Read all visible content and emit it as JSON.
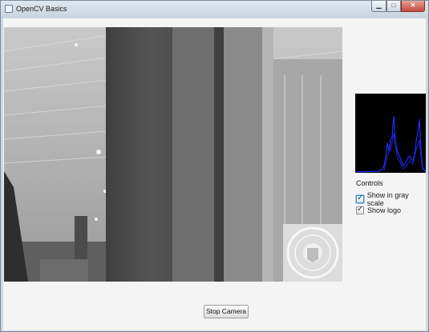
{
  "window": {
    "title": "OpenCV Basics",
    "minimize_glyph": "▁",
    "maximize_glyph": "□",
    "close_glyph": "✕"
  },
  "controls": {
    "heading": "Controls",
    "gray_scale": {
      "label": "Show in gray scale",
      "checked": true
    },
    "show_logo": {
      "label": "Show logo",
      "checked": true
    }
  },
  "actions": {
    "stop_camera_label": "Stop Camera"
  },
  "colors": {
    "histogram_bg": "#000000",
    "histogram_line": "#1f2cff",
    "focus_ring": "#3c8ac9"
  },
  "icons": [
    "app-icon",
    "minimize-icon",
    "maximize-icon",
    "close-icon",
    "check-icon"
  ]
}
